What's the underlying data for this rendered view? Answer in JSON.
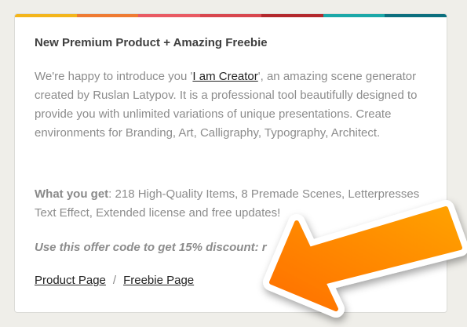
{
  "stripe_colors": [
    "#f3b51b",
    "#ef7b32",
    "#e95a63",
    "#d8464e",
    "#b3282c",
    "#1ba8a8",
    "#0b6f7e"
  ],
  "card": {
    "title": "New Premium Product + Amazing Freebie",
    "intro_before": "We're happy to introduce you '",
    "intro_link": "I am Creator",
    "intro_after": "', an amazing scene generator created by Ruslan Latypov. It is a professional tool beautifully designed to provide you with unlimited variations of unique presentations. Create environments for Branding, Art, Calligraphy, Typography, Architect.",
    "get_label": "What you get",
    "get_text": ": 218 High-Quality Items, 8 Premade Scenes, Letterpresses Text Effect, Extended license and free updates!",
    "offer_text": "Use this offer code to get 15% discount: r",
    "product_link": "Product Page",
    "separator": "/",
    "freebie_link": "Freebie Page"
  },
  "arrow": {
    "color": "#ff8a00",
    "icon": "arrow-pointer-icon"
  }
}
